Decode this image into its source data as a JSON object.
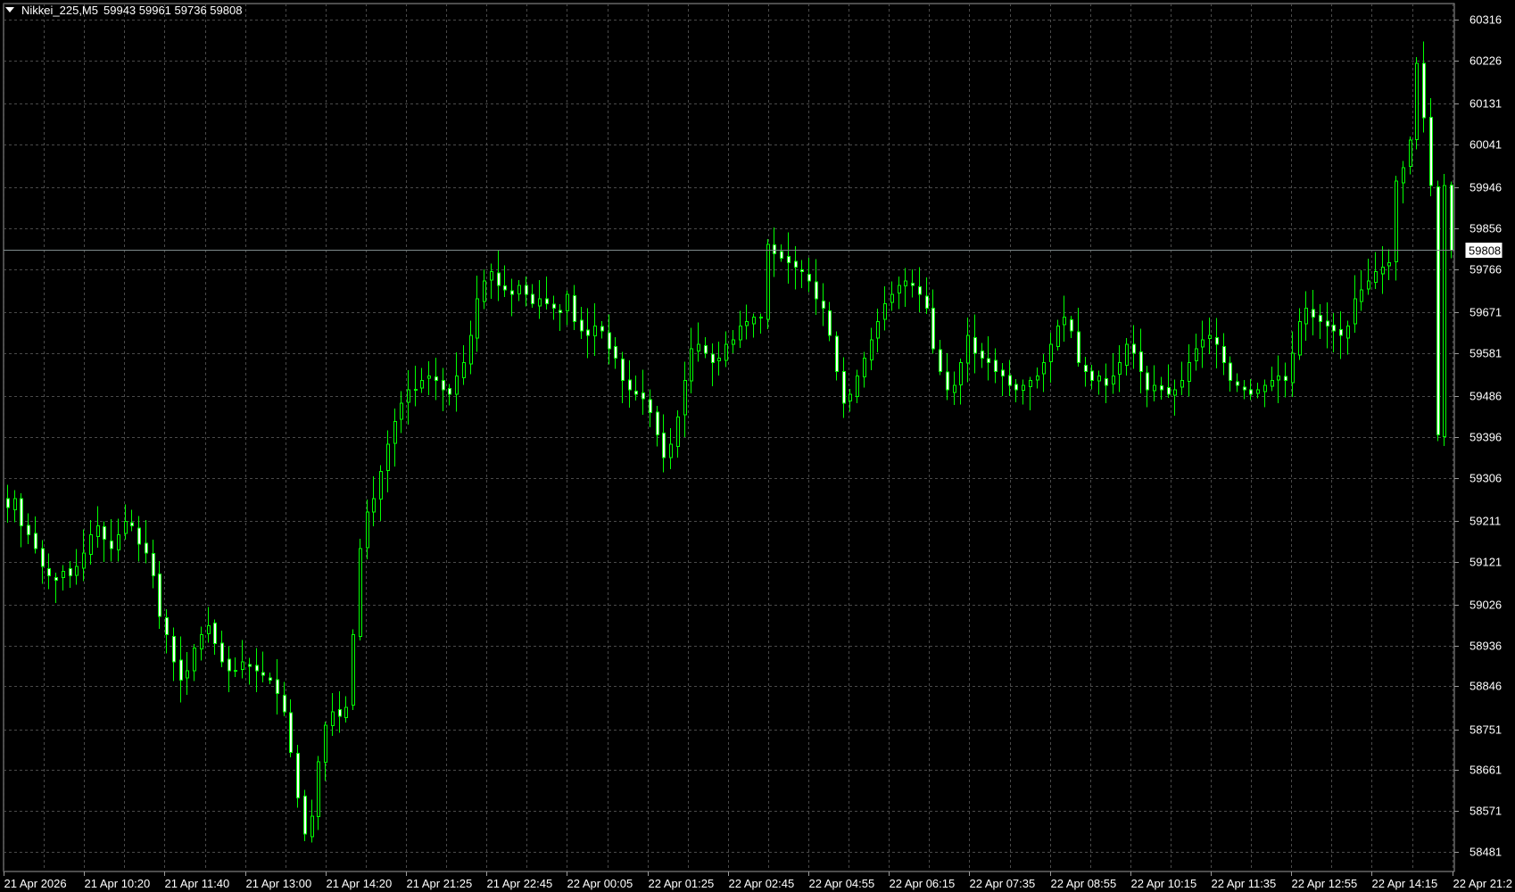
{
  "title": {
    "symbol_period": "Nikkei_225,M5",
    "ohlc": "59943 59961 59736 59808"
  },
  "colors": {
    "background": "#000000",
    "grid": "#4a4a4a",
    "candle_up_outline": "#00ff00",
    "candle_down_fill": "#ffffff",
    "bid_line": "#7f8c8d",
    "text": "#ffffff"
  },
  "chart_data": {
    "type": "candlestick",
    "symbol": "Nikkei_225",
    "timeframe": "M5",
    "ylim": [
      58440,
      60350
    ],
    "y_ticks": [
      60316,
      60226,
      60131,
      60041,
      59946,
      59856,
      59766,
      59671,
      59581,
      59486,
      59396,
      59306,
      59211,
      59121,
      59026,
      58936,
      58846,
      58751,
      58661,
      58571,
      58481
    ],
    "x_ticks": [
      "21 Apr 2026",
      "21 Apr 10:20",
      "21 Apr 11:40",
      "21 Apr 13:00",
      "21 Apr 14:20",
      "21 Apr 21:25",
      "21 Apr 22:45",
      "22 Apr 00:05",
      "22 Apr 01:25",
      "22 Apr 02:45",
      "22 Apr 04:55",
      "22 Apr 06:15",
      "22 Apr 07:35",
      "22 Apr 08:55",
      "22 Apr 10:15",
      "22 Apr 11:35",
      "22 Apr 12:55",
      "22 Apr 14:15",
      "22 Apr 21:2"
    ],
    "current_price": 59808,
    "grid": true,
    "series": [
      {
        "name": "",
        "close_path": [
          59240,
          59260,
          59200,
          59180,
          59150,
          59110,
          59090,
          59080,
          59100,
          59090,
          59110,
          59140,
          59180,
          59200,
          59170,
          59150,
          59180,
          59210,
          59200,
          59160,
          59140,
          59090,
          59000,
          58960,
          58900,
          58860,
          58880,
          58930,
          58960,
          58980,
          58940,
          58900,
          58880,
          58880,
          58900,
          58890,
          58880,
          58870,
          58860,
          58830,
          58790,
          58700,
          58600,
          58520,
          58560,
          58680,
          58760,
          58790,
          58780,
          58800,
          58960,
          59150,
          59230,
          59260,
          59320,
          59380,
          59430,
          59470,
          59500,
          59500,
          59520,
          59530,
          59520,
          59500,
          59490,
          59530,
          59560,
          59620,
          59700,
          59740,
          59760,
          59730,
          59720,
          59710,
          59730,
          59710,
          59690,
          59700,
          59690,
          59680,
          59670,
          59710,
          59650,
          59630,
          59620,
          59640,
          59630,
          59590,
          59570,
          59520,
          59500,
          59490,
          59480,
          59450,
          59400,
          59350,
          59380,
          59440,
          59520,
          59590,
          59600,
          59580,
          59560,
          59570,
          59600,
          59610,
          59640,
          59650,
          59660,
          59660,
          59820,
          59800,
          59790,
          59780,
          59770,
          59760,
          59740,
          59700,
          59680,
          59620,
          59540,
          59470,
          59490,
          59530,
          59570,
          59610,
          59650,
          59690,
          59710,
          59730,
          59740,
          59730,
          59710,
          59680,
          59590,
          59540,
          59500,
          59510,
          59560,
          59620,
          59580,
          59570,
          59560,
          59540,
          59530,
          59510,
          59500,
          59510,
          59520,
          59530,
          59560,
          59600,
          59640,
          59660,
          59630,
          59560,
          59540,
          59520,
          59530,
          59510,
          59530,
          59560,
          59600,
          59580,
          59540,
          59500,
          59510,
          59500,
          59490,
          59500,
          59520,
          59560,
          59590,
          59610,
          59620,
          59600,
          59560,
          59520,
          59510,
          59500,
          59490,
          59500,
          59510,
          59520,
          59530,
          59520,
          59580,
          59650,
          59680,
          59660,
          59650,
          59640,
          59630,
          59620,
          59640,
          59700,
          59720,
          59740,
          59760,
          59770,
          59780,
          59960,
          59990,
          60050,
          60220,
          60100,
          59950,
          59400,
          59950,
          59808
        ]
      }
    ]
  }
}
